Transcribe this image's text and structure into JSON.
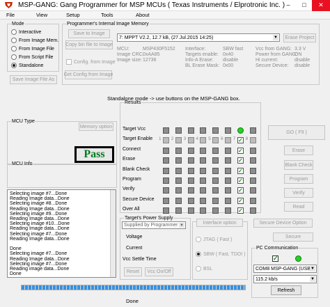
{
  "window": {
    "title": "MSP-GANG:  Gang Programmer for MSP MCUs  ( Texas Instruments / Elprotronic Inc. )",
    "minimize": "–",
    "maximize": "□",
    "close": "✕",
    "close_color": "#e81123"
  },
  "menu": [
    "File",
    "View",
    "Setup",
    "Tools",
    "About"
  ],
  "mode": {
    "legend": "Mode",
    "options": [
      "Interactive",
      "From Image Mem.",
      "From Image File",
      "From Script File",
      "Standalone"
    ],
    "selected": "Standalone",
    "save_button": "Save Image File As"
  },
  "memory": {
    "legend": "Programmer's Internal Image Memory",
    "save_to_image": "Save to Image",
    "copy_bin": "Copy bin file to Image",
    "config_from_image": "Config. from Image",
    "get_config": "Get Config from Image",
    "image_select": "7: MPPT V2.2,  12.7 kB,  (27.Jul.2015  14:25)",
    "erase_project": "Erase Project",
    "mcu_label": "MCU:",
    "mcu_value": "MSP430F5152",
    "crc_label": "Image CRC:",
    "crc_value": "0xAA85",
    "size_label": "Image size:",
    "size_value": "12736",
    "interface_label": "Interface:",
    "interface_value": "SBW fast",
    "targets_label": "Targets enable:",
    "targets_value": "0x40",
    "infoa_label": "Info-A Erase:",
    "infoa_value": "disable",
    "blerase_label": "BL Erase Mask:",
    "blerase_value": "0x00",
    "vcc_label": "Vcc from GANG:",
    "vcc_value": "3.3 V",
    "power_label": "Power from GANG:",
    "power_value": "ON",
    "hicurrent_label": "Hi current:",
    "hicurrent_value": "disable",
    "secure_label": "Secure Device:",
    "secure_value": "disable"
  },
  "standalone_msg": "Standalone mode -> use buttons on the MSP-GANG box.",
  "mcu_type": {
    "legend": "MCU Type",
    "memory_option": "Memory option"
  },
  "pass_text": "Pass",
  "mcu_info": {
    "legend": "MCU Info"
  },
  "log": [
    "Selecting image #7...Done",
    "Reading Image data...Done",
    "Selecting image #8...Done",
    "Reading Image data...Done",
    "Selecting image #9...Done",
    "Reading Image data...Done",
    "Selecting image #10...Done",
    "Reading Image data...Done",
    "Selecting image #7...Done",
    "Reading Image data...Done",
    "",
    "Done",
    "Selecting image #7...Done",
    "Reading Image data...Done",
    "Selecting image #7...Done",
    "Reading image data...Done",
    "Done"
  ],
  "results": {
    "legend": "Results",
    "rows": [
      "Target Vcc",
      "Target Enable",
      "Connect",
      "Erase",
      "Blank Check",
      "Program",
      "Verify",
      "Secure Device",
      "Over All"
    ],
    "target_numbers": [
      "1",
      "2",
      "3",
      "4",
      "5",
      "6",
      "7",
      "8"
    ],
    "active_target": "7",
    "active_color": "#24d324"
  },
  "actions": {
    "go": "GO     ( F9 )",
    "erase": "Erase",
    "blank_check": "Blank Check",
    "program": "Program",
    "verify": "Verify",
    "read": "Read"
  },
  "power": {
    "legend": "Target's Power Supply",
    "select": "Supplied by Programmer",
    "voltage": "Voltage",
    "current": "Current",
    "settle": "Vcc Settle Time",
    "reset": "Reset",
    "vcc_toggle": "Vcc On/Off"
  },
  "interface": {
    "button": "Interface option",
    "options": [
      "JTAG ( Fast )",
      "SBW ( Fast, TDOI )",
      "BSL"
    ],
    "selected": "SBW ( Fast, TDOI )"
  },
  "secure": {
    "option": "Secure Device Option",
    "button": "Secure"
  },
  "pc_comm": {
    "legend": "PC Communication",
    "port": "COM8  MSP-GANG (USB)",
    "baud": "115.2 kb/s",
    "refresh": "Refresh"
  },
  "status": {
    "text": "Done",
    "progress": 1.0,
    "progress_color": "#3a8fd8"
  }
}
